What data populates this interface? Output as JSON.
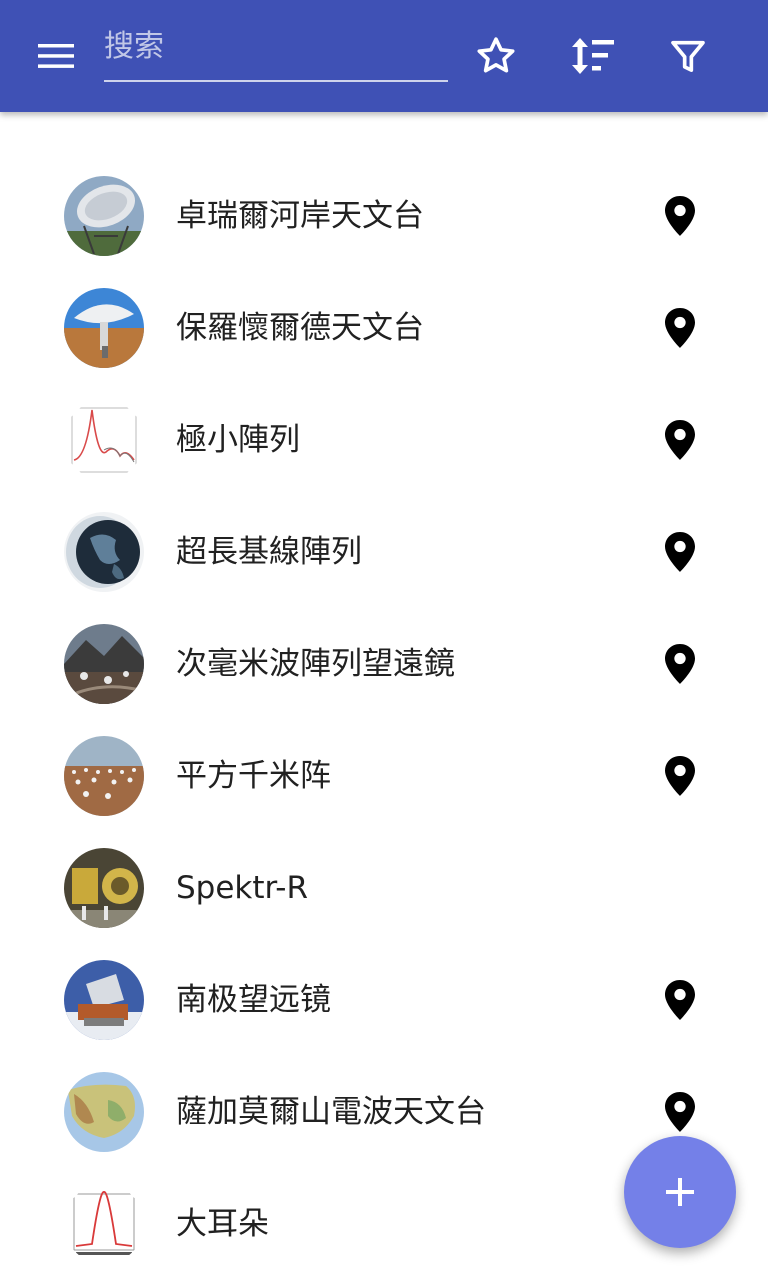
{
  "app_bar": {
    "search_placeholder": "搜索",
    "search_value": "",
    "icons": {
      "menu": "menu-icon",
      "favorites": "star-outline-icon",
      "sort": "sort-icon",
      "filter": "filter-icon"
    },
    "background_color": "#3f51b5"
  },
  "items": [
    {
      "label": "卓瑞爾河岸天文台",
      "thumbnail": "radio-dish-photo",
      "has_location": true
    },
    {
      "label": "保羅懷爾德天文台",
      "thumbnail": "dish-antenna-photo",
      "has_location": true
    },
    {
      "label": "極小陣列",
      "thumbnail": "spectrum-plot-image",
      "has_location": true
    },
    {
      "label": "超長基線陣列",
      "thumbnail": "globe-render-image",
      "has_location": true
    },
    {
      "label": "次毫米波陣列望遠鏡",
      "thumbnail": "mountain-array-photo",
      "has_location": true
    },
    {
      "label": "平方千米阵",
      "thumbnail": "desert-array-photo",
      "has_location": true
    },
    {
      "label": "Spektr-R",
      "thumbnail": "satellite-assembly-photo",
      "has_location": false
    },
    {
      "label": "南极望远镜",
      "thumbnail": "polar-telescope-photo",
      "has_location": true
    },
    {
      "label": "薩加莫爾山電波天文台",
      "thumbnail": "relief-map-image",
      "has_location": true
    },
    {
      "label": "大耳朵",
      "thumbnail": "signal-plot-image",
      "has_location": false
    }
  ],
  "fab": {
    "icon": "plus-icon",
    "color": "#7480e8"
  }
}
